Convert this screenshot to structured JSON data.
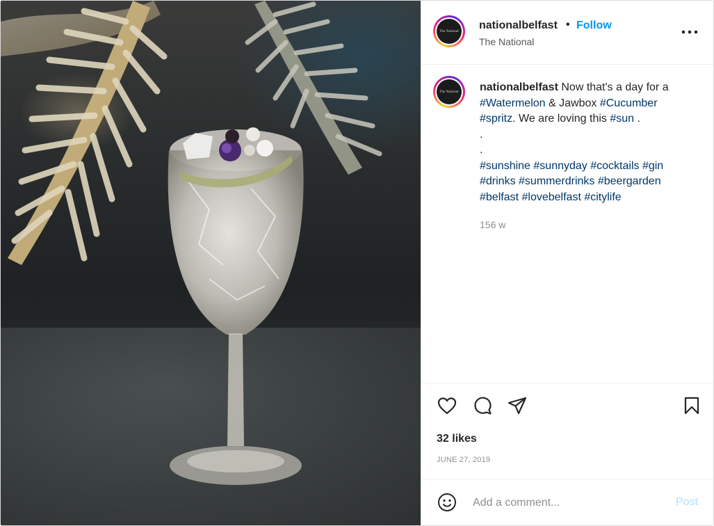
{
  "post": {
    "username": "nationalbelfast",
    "separator": "•",
    "follow_label": "Follow",
    "location": "The National",
    "avatar_text": "The National",
    "caption": {
      "author": "nationalbelfast",
      "lines": [
        [
          "Now that's a day for a",
          ""
        ],
        [
          "",
          "#Watermelon"
        ],
        [
          " & Jawbox ",
          "#Cucumber"
        ],
        [
          "",
          "#spritz"
        ],
        [
          ". We are loving this ",
          "#sun"
        ],
        [
          " .",
          ""
        ]
      ],
      "line1": "Now that's a day for a",
      "line2_tag1": "#Watermelon",
      "line2_text": " & Jawbox ",
      "line2_tag2": "#Cucumber",
      "line3_tag1": "#spritz",
      "line3_text": ". We are loving this ",
      "line3_tag2": "#sun",
      "line3_end": " .",
      "dot1": ".",
      "dot2": ".",
      "hashtags_row1": [
        "#sunshine",
        "#sunnyday",
        "#cocktails",
        "#gin"
      ],
      "hashtags_row2": [
        "#drinks",
        "#summerdrinks",
        "#beergarden"
      ],
      "hashtags_row3": [
        "#belfast",
        "#lovebelfast",
        "#citylife"
      ]
    },
    "time_ago": "156 w",
    "likes": "32 likes",
    "date": "JUNE 27, 2019"
  },
  "actions": {
    "like_icon": "heart-icon",
    "comment_icon": "comment-bubble-icon",
    "share_icon": "paper-plane-icon",
    "save_icon": "bookmark-icon",
    "more_icon": "more-horizontal-icon"
  },
  "comment": {
    "placeholder": "Add a comment...",
    "post_label": "Post",
    "emoji_icon": "smiley-icon"
  },
  "colors": {
    "link_blue": "#0095f6",
    "hashtag": "#00376b",
    "post_disabled": "#b2dffc",
    "muted": "#8e8e8e"
  }
}
